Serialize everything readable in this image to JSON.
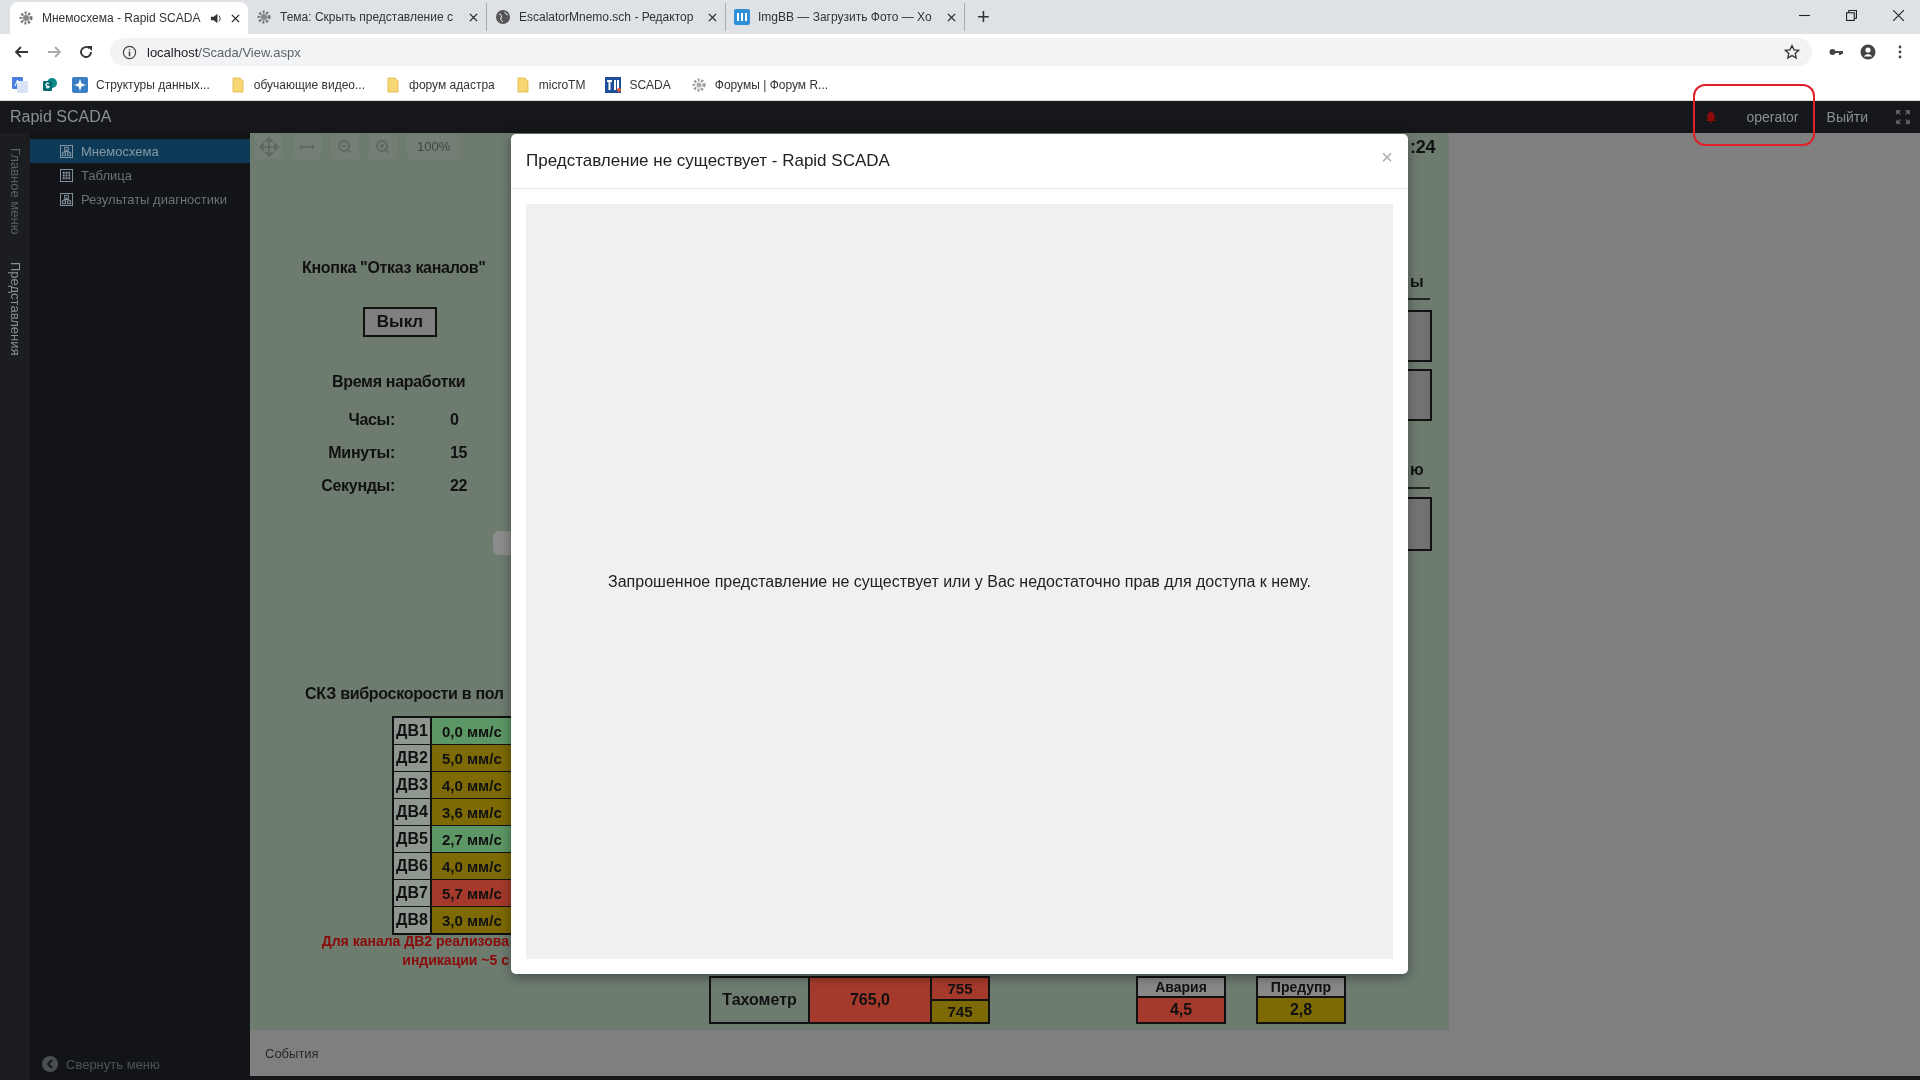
{
  "browser": {
    "tabs": [
      {
        "title": "Мнемосхема - Rapid SCADA",
        "kind": "gear",
        "audio": true,
        "selected": true
      },
      {
        "title": "Тема: Скрыть представление с",
        "kind": "gear",
        "audio": false,
        "selected": false
      },
      {
        "title": "EscalatorMnemo.sch - Редактор",
        "kind": "globe",
        "audio": false,
        "selected": false
      },
      {
        "title": "ImgBB — Загрузить Фото — Хо",
        "kind": "badge",
        "audio": false,
        "selected": false
      }
    ],
    "new_tab": "+",
    "address": {
      "host": "localhost",
      "path": "/Scada/View.aspx"
    },
    "bookmarks": [
      {
        "kind": "translate"
      },
      {
        "kind": "sheet"
      },
      {
        "kind": "app",
        "label": "Структуры данных..."
      },
      {
        "kind": "folder",
        "label": "обучающие видео..."
      },
      {
        "kind": "folder",
        "label": "форум адастра"
      },
      {
        "kind": "folder",
        "label": "microTM"
      },
      {
        "kind": "tm",
        "label": "SCADA"
      },
      {
        "kind": "gear",
        "label": "Форумы | Форум R..."
      }
    ]
  },
  "app": {
    "brand": "Rapid SCADA",
    "user": "operator",
    "logout": "Выйти",
    "alarm_active": true,
    "rail": [
      {
        "label": "Главное меню",
        "selected": false
      },
      {
        "label": "Представления",
        "selected": true
      }
    ],
    "views": [
      {
        "label": "Мнемосхема",
        "kind": "scheme",
        "selected": true
      },
      {
        "label": "Таблица",
        "kind": "table",
        "selected": false
      },
      {
        "label": "Результаты диагностики",
        "kind": "scheme",
        "selected": false
      }
    ],
    "collapse": "Свернуть меню",
    "zoom": "100%",
    "events": "События"
  },
  "scheme": {
    "button_title": "Кнопка \"Отказ каналов\"",
    "button_label": "Выкл",
    "runtime_title": "Время наработки",
    "runtime": [
      {
        "label": "Часы:",
        "value": "0"
      },
      {
        "label": "Минуты:",
        "value": "15"
      },
      {
        "label": "Секунды:",
        "value": "22"
      }
    ],
    "vibration_title": "СКЗ виброскорости в пол",
    "channels": [
      {
        "name": "ДВ1",
        "value": "0,0 мм/с",
        "color": "#5e9766"
      },
      {
        "name": "ДВ2",
        "value": "5,0 мм/с",
        "color": "#7d6a05"
      },
      {
        "name": "ДВ3",
        "value": "4,0 мм/с",
        "color": "#7d6a05"
      },
      {
        "name": "ДВ4",
        "value": "3,6 мм/с",
        "color": "#7d6a05"
      },
      {
        "name": "ДВ5",
        "value": "2,7 мм/с",
        "color": "#5e9766"
      },
      {
        "name": "ДВ6",
        "value": "4,0 мм/с",
        "color": "#7d6a05"
      },
      {
        "name": "ДВ7",
        "value": "5,7 мм/с",
        "color": "#a53a2c"
      },
      {
        "name": "ДВ8",
        "value": "3,0 мм/с",
        "color": "#7d6a05"
      }
    ],
    "note": [
      "Для канала ДВ2 реализова",
      "индикации ~5 с"
    ],
    "tach": {
      "label": "Тахометр",
      "value": "765,0",
      "color": "#a53a2c",
      "limits": [
        {
          "value": "755",
          "color": "#a53a2c"
        },
        {
          "value": "745",
          "color": "#7d6a05"
        }
      ]
    },
    "limits": [
      {
        "label": "Авария",
        "value": "4,5",
        "color": "#a53a2c"
      },
      {
        "label": "Предупр",
        "value": "2,8",
        "color": "#7d6a05"
      }
    ],
    "time": ":24",
    "fragments": [
      "ы",
      "ю"
    ]
  },
  "modal": {
    "title": "Представление не существует - Rapid SCADA",
    "close": "×",
    "message": "Запрошенное представление не существует или у Вас недостаточно прав для доступа к нему."
  }
}
